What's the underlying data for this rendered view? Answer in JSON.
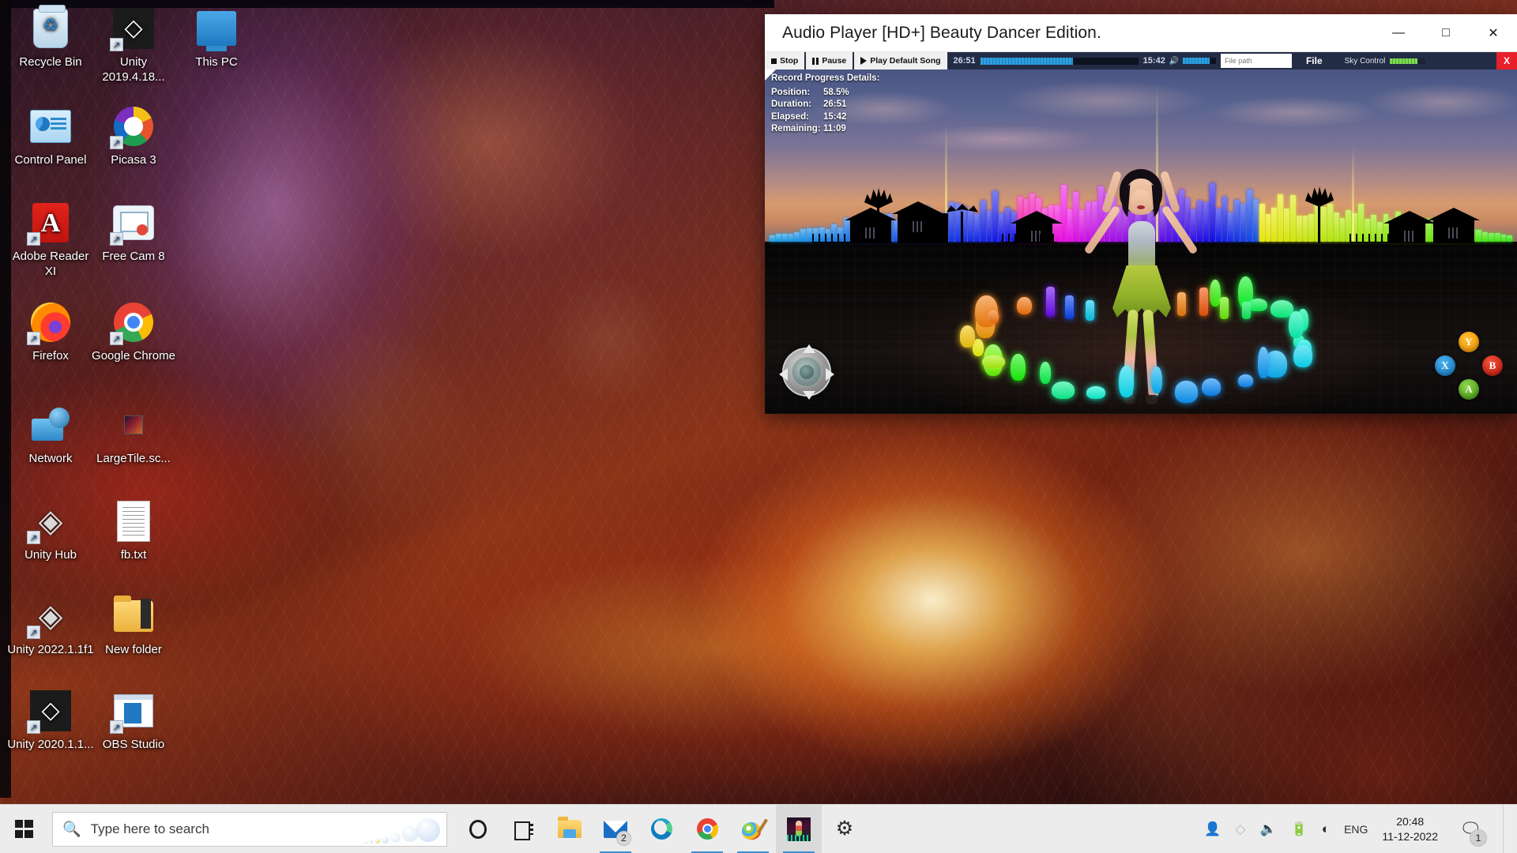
{
  "desktop": {
    "icons": [
      {
        "label": "Recycle Bin",
        "icon": "recycle-bin-icon",
        "shortcut": false,
        "col": 0,
        "row": 0
      },
      {
        "label": "Unity 2019.4.18...",
        "icon": "unity-editor-icon",
        "shortcut": true,
        "col": 1,
        "row": 0
      },
      {
        "label": "This PC",
        "icon": "this-pc-icon",
        "shortcut": false,
        "col": 2,
        "row": 0
      },
      {
        "label": "Control Panel",
        "icon": "control-panel-icon",
        "shortcut": false,
        "col": 0,
        "row": 1
      },
      {
        "label": "Picasa 3",
        "icon": "picasa-icon",
        "shortcut": true,
        "col": 1,
        "row": 1
      },
      {
        "label": "Adobe Reader XI",
        "icon": "adobe-reader-icon",
        "shortcut": true,
        "col": 0,
        "row": 2
      },
      {
        "label": "Free Cam 8",
        "icon": "free-cam-icon",
        "shortcut": true,
        "col": 1,
        "row": 2
      },
      {
        "label": "Firefox",
        "icon": "firefox-icon",
        "shortcut": true,
        "col": 0,
        "row": 3
      },
      {
        "label": "Google Chrome",
        "icon": "chrome-icon",
        "shortcut": true,
        "col": 1,
        "row": 3
      },
      {
        "label": "Network",
        "icon": "network-icon",
        "shortcut": false,
        "col": 0,
        "row": 4
      },
      {
        "label": "LargeTile.sc...",
        "icon": "image-file-icon",
        "shortcut": false,
        "col": 1,
        "row": 4
      },
      {
        "label": "Unity Hub",
        "icon": "unity-hub-icon",
        "shortcut": true,
        "col": 0,
        "row": 5
      },
      {
        "label": "fb.txt",
        "icon": "text-file-icon",
        "shortcut": false,
        "col": 1,
        "row": 5
      },
      {
        "label": "Unity 2022.1.1f1",
        "icon": "unity-hub-icon",
        "shortcut": true,
        "col": 0,
        "row": 6
      },
      {
        "label": "New folder",
        "icon": "folder-icon",
        "shortcut": false,
        "col": 1,
        "row": 6
      },
      {
        "label": "Unity 2020.1.1...",
        "icon": "unity-editor-icon",
        "shortcut": true,
        "col": 0,
        "row": 7
      },
      {
        "label": "OBS Studio",
        "icon": "obs-studio-icon",
        "shortcut": true,
        "col": 1,
        "row": 7
      }
    ]
  },
  "player": {
    "title": "Audio Player [HD+] Beauty Dancer Edition.",
    "window_buttons": {
      "minimize": "—",
      "maximize": "□",
      "close": "✕"
    },
    "toolbar": {
      "stop_label": "Stop",
      "pause_label": "Pause",
      "play_default_label": "Play Default Song",
      "total_time": "26:51",
      "elapsed_time": "15:42",
      "seek_percent": 58.5,
      "volume_percent": 80,
      "file_path_value": "",
      "file_path_placeholder": "File path",
      "file_button_label": "File",
      "sky_control_label": "Sky Control",
      "sky_control_percent": 78,
      "close_x_label": "X"
    },
    "details": {
      "heading": "Record Progress Details:",
      "rows": [
        {
          "key": "Position:",
          "value": "58.5%"
        },
        {
          "key": "Duration:",
          "value": "26:51"
        },
        {
          "key": "Elapsed:",
          "value": "15:42"
        },
        {
          "key": "Remaining:",
          "value": "11:09"
        }
      ]
    },
    "gamepad": {
      "y": "Y",
      "x": "X",
      "b": "B",
      "a": "A"
    },
    "colors": {
      "toolbar_bg": "#232c45",
      "seek_fill": "#2e9fe0",
      "sky_fill": "#7ed957",
      "close_red": "#e8202a",
      "gp_y": "#f29100",
      "gp_x": "#1578c0",
      "gp_b": "#c2180c",
      "gp_a": "#3e9a16"
    }
  },
  "taskbar": {
    "start_label": "Start",
    "search": {
      "placeholder": "Type here to search",
      "value": ""
    },
    "apps": [
      {
        "name": "cortana",
        "glyph": "g-cortana",
        "label": "Cortana",
        "active": false,
        "running": false,
        "badge": ""
      },
      {
        "name": "task-view",
        "glyph": "g-taskview",
        "label": "Task View",
        "active": false,
        "running": false,
        "badge": ""
      },
      {
        "name": "file-explorer",
        "glyph": "g-explorer",
        "label": "File Explorer",
        "active": false,
        "running": false,
        "badge": ""
      },
      {
        "name": "mail",
        "glyph": "g-mail",
        "label": "Mail",
        "active": false,
        "running": true,
        "badge": "2"
      },
      {
        "name": "edge",
        "glyph": "g-edge",
        "label": "Microsoft Edge",
        "active": false,
        "running": false,
        "badge": ""
      },
      {
        "name": "chrome",
        "glyph": "g-chrome",
        "label": "Google Chrome",
        "active": false,
        "running": true,
        "badge": ""
      },
      {
        "name": "paint",
        "glyph": "g-paint",
        "label": "Paint",
        "active": false,
        "running": true,
        "badge": ""
      },
      {
        "name": "audio-player",
        "glyph": "g-player",
        "label": "Audio Player",
        "active": true,
        "running": true,
        "badge": ""
      },
      {
        "name": "settings",
        "glyph": "g-gear",
        "label": "Settings",
        "active": false,
        "running": false,
        "badge": ""
      }
    ],
    "tray": {
      "people_icon": "\u0000",
      "unity_icon": "unity-tray-icon",
      "volume_icon": "volume-icon",
      "battery_icon": "battery-icon",
      "network_icon": "wifi-icon",
      "language": "ENG"
    },
    "clock": {
      "time": "20:48",
      "date": "11-12-2022"
    },
    "action_center": {
      "count": "1"
    }
  }
}
